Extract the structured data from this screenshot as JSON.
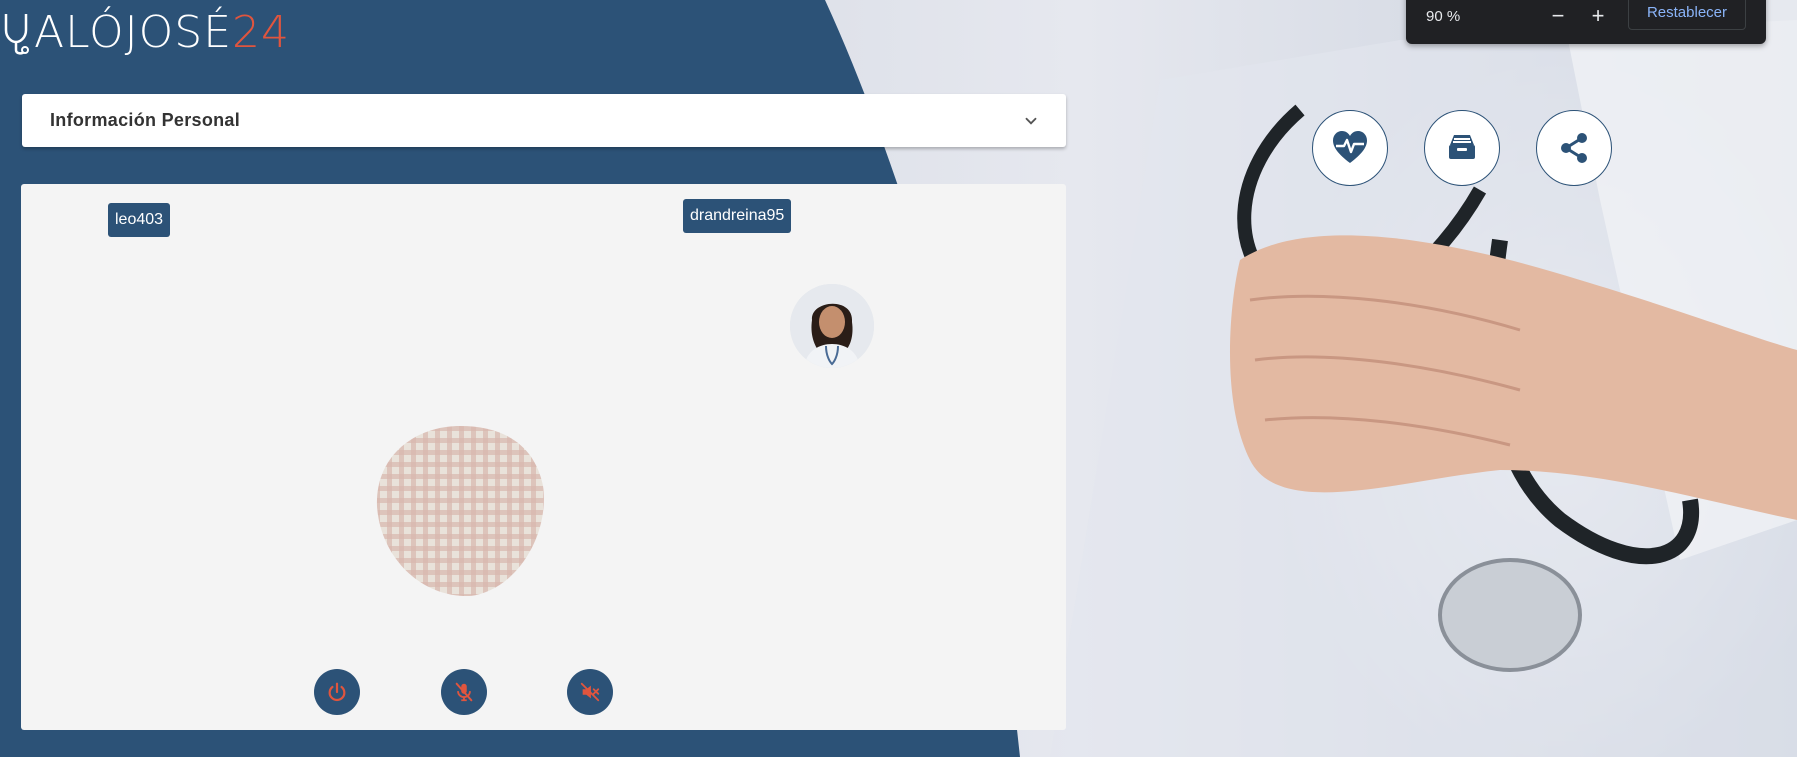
{
  "brand": {
    "logo_text": "ALÓJOSÉ",
    "logo_number": "24",
    "colors": {
      "primary": "#2c5277",
      "accent": "#e0553e",
      "panel": "#f4f4f4"
    }
  },
  "accordion": {
    "title": "Información Personal",
    "icon": "chevron-down-icon"
  },
  "video_call": {
    "local_user": "leo403",
    "remote_user": "drandreina95",
    "controls": [
      {
        "name": "hangup",
        "icon": "power-icon"
      },
      {
        "name": "mute-mic",
        "icon": "mic-off-icon"
      },
      {
        "name": "mute-speaker",
        "icon": "speaker-off-icon"
      }
    ]
  },
  "quick_actions": [
    {
      "name": "health",
      "icon": "heart-pulse-icon"
    },
    {
      "name": "archive",
      "icon": "archive-icon"
    },
    {
      "name": "share",
      "icon": "share-icon"
    }
  ],
  "zoom_popup": {
    "level": "90 %",
    "minus": "−",
    "plus": "+",
    "reset_label": "Restablecer"
  }
}
